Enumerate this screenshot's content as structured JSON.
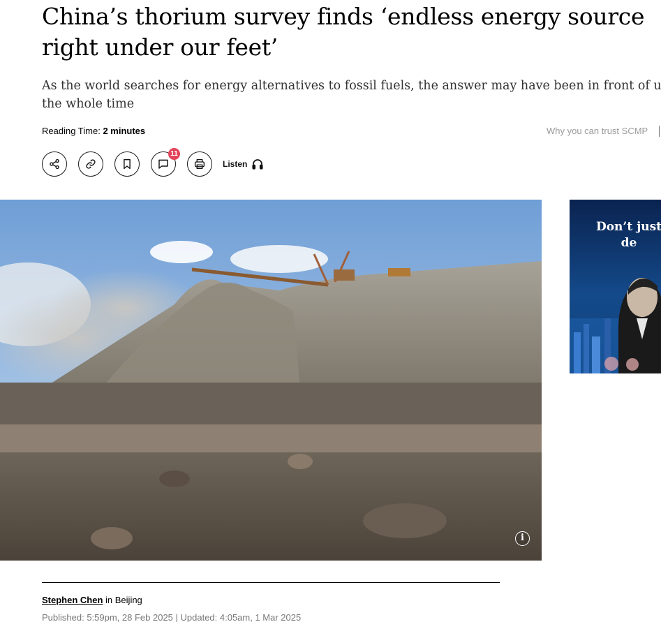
{
  "article": {
    "headline": "China’s thorium survey finds ‘endless energy source right under our feet’",
    "subheadline_line1": "As the world searches for energy alternatives to fossil fuels, the answer may have been in front of us",
    "subheadline_line2": "the whole time",
    "reading_time_label": "Reading Time:",
    "reading_time_value": "2 minutes",
    "trust_link": "Why you can trust SCMP",
    "author": "Stephen Chen",
    "location": "in Beijing",
    "published": "Published: 5:59pm, 28 Feb 2025 | Updated: 4:05am, 1 Mar 2025"
  },
  "toolbar": {
    "share_icon": "share-icon",
    "link_icon": "link-icon",
    "bookmark_icon": "bookmark-icon",
    "comment_icon": "comment-icon",
    "comment_count": "11",
    "print_icon": "print-icon",
    "listen_label": "Listen",
    "listen_icon": "headphones-icon"
  },
  "hero": {
    "image": "open-pit mine spoil heaps with conveyor stacker",
    "info_icon": "info-icon",
    "info_glyph": "i"
  },
  "ad": {
    "line1": "Don’t just",
    "line2": "de"
  },
  "colors": {
    "badge": "#e2455a",
    "trust_link": "#9a9a9a",
    "published": "#777777",
    "ad_background": "#0c2d63"
  }
}
